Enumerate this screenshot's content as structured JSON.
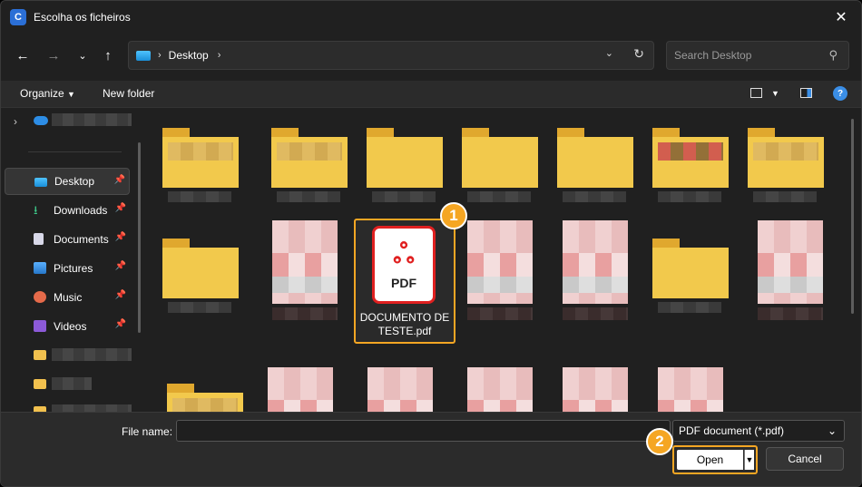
{
  "window": {
    "title": "Escolha os ficheiros",
    "app_icon": "app-logo-icon"
  },
  "address": {
    "location": "Desktop"
  },
  "search": {
    "placeholder": "Search Desktop"
  },
  "command_bar": {
    "organize_label": "Organize",
    "new_folder_label": "New folder",
    "help_label": "?"
  },
  "sidebar": {
    "items": [
      {
        "label": "Desktop",
        "icon": "desktop-icon",
        "pinned": true,
        "selected": true
      },
      {
        "label": "Downloads",
        "icon": "download-icon",
        "pinned": true
      },
      {
        "label": "Documents",
        "icon": "documents-icon",
        "pinned": true
      },
      {
        "label": "Pictures",
        "icon": "pictures-icon",
        "pinned": true
      },
      {
        "label": "Music",
        "icon": "music-icon",
        "pinned": true
      },
      {
        "label": "Videos",
        "icon": "videos-icon",
        "pinned": true
      }
    ]
  },
  "content": {
    "selected_file": {
      "name_line1": "DOCUMENTO DE",
      "name_line2": "TESTE.pdf",
      "icon_label": "PDF"
    }
  },
  "badges": {
    "step1": "1",
    "step2": "2",
    "color": "#f5a623"
  },
  "footer": {
    "file_name_label": "File name:",
    "file_name_value": "",
    "file_type": "PDF document (*.pdf)",
    "open_label": "Open",
    "cancel_label": "Cancel"
  }
}
